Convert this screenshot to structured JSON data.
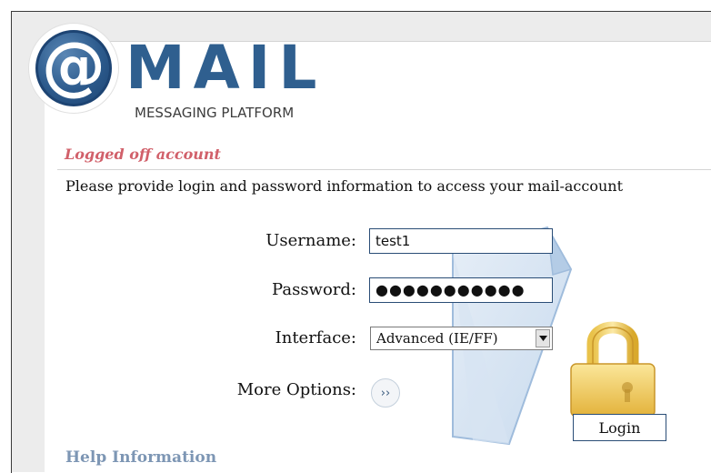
{
  "logo": {
    "at_symbol": "@",
    "name": "MAIL",
    "subtitle": "MESSAGING PLATFORM"
  },
  "status": {
    "title": "Logged off account",
    "instructions": "Please provide login and password information to access your mail-account"
  },
  "form": {
    "username_label": "Username:",
    "username_value": "test1",
    "password_label": "Password:",
    "password_value": "●●●●●●●●●●●",
    "interface_label": "Interface:",
    "interface_selected": "Advanced (IE/FF)",
    "more_options_label": "More Options:",
    "more_options_icon": "››",
    "login_label": "Login"
  },
  "help": {
    "title": "Help Information"
  },
  "colors": {
    "accent": "#2f5f8f",
    "status_red": "#d1606a",
    "help_blue": "#7d96b4"
  }
}
